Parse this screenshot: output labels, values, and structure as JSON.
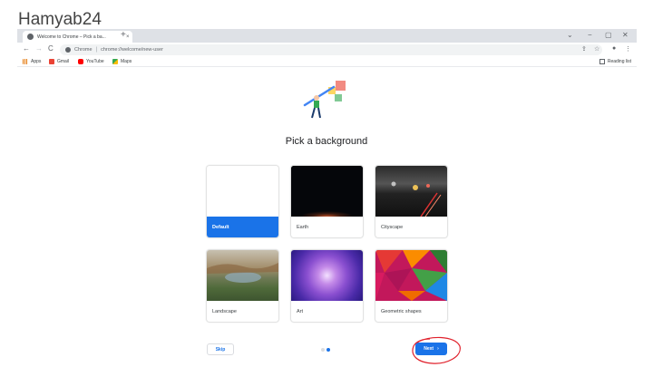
{
  "watermark": "Hamyab24",
  "tab": {
    "title": "Welcome to Chrome – Pick a ba...",
    "close": "×",
    "new_tab": "+"
  },
  "window_controls": {
    "minimize": "−",
    "maximize": "▢",
    "close": "✕",
    "menu": "⌄"
  },
  "toolbar": {
    "back": "←",
    "forward": "→",
    "reload": "C",
    "site_label": "Chrome",
    "separator": "|",
    "url": "chrome://welcome/new-user",
    "share": "⇪",
    "star": "☆",
    "profile": "●",
    "menu": "⋮"
  },
  "bookmarks": {
    "items": [
      "Apps",
      "Gmail",
      "YouTube",
      "Maps"
    ],
    "reading_list": "Reading list"
  },
  "page": {
    "heading": "Pick a background"
  },
  "backgrounds": [
    {
      "label": "Default",
      "selected": true
    },
    {
      "label": "Earth",
      "selected": false
    },
    {
      "label": "Cityscape",
      "selected": false
    },
    {
      "label": "Landscape",
      "selected": false
    },
    {
      "label": "Art",
      "selected": false
    },
    {
      "label": "Geometric shapes",
      "selected": false
    }
  ],
  "footer": {
    "skip": "Skip",
    "next": "Next",
    "next_arrow": "›"
  },
  "colors": {
    "accent": "#1a73e8",
    "annotation": "#e0202b"
  }
}
